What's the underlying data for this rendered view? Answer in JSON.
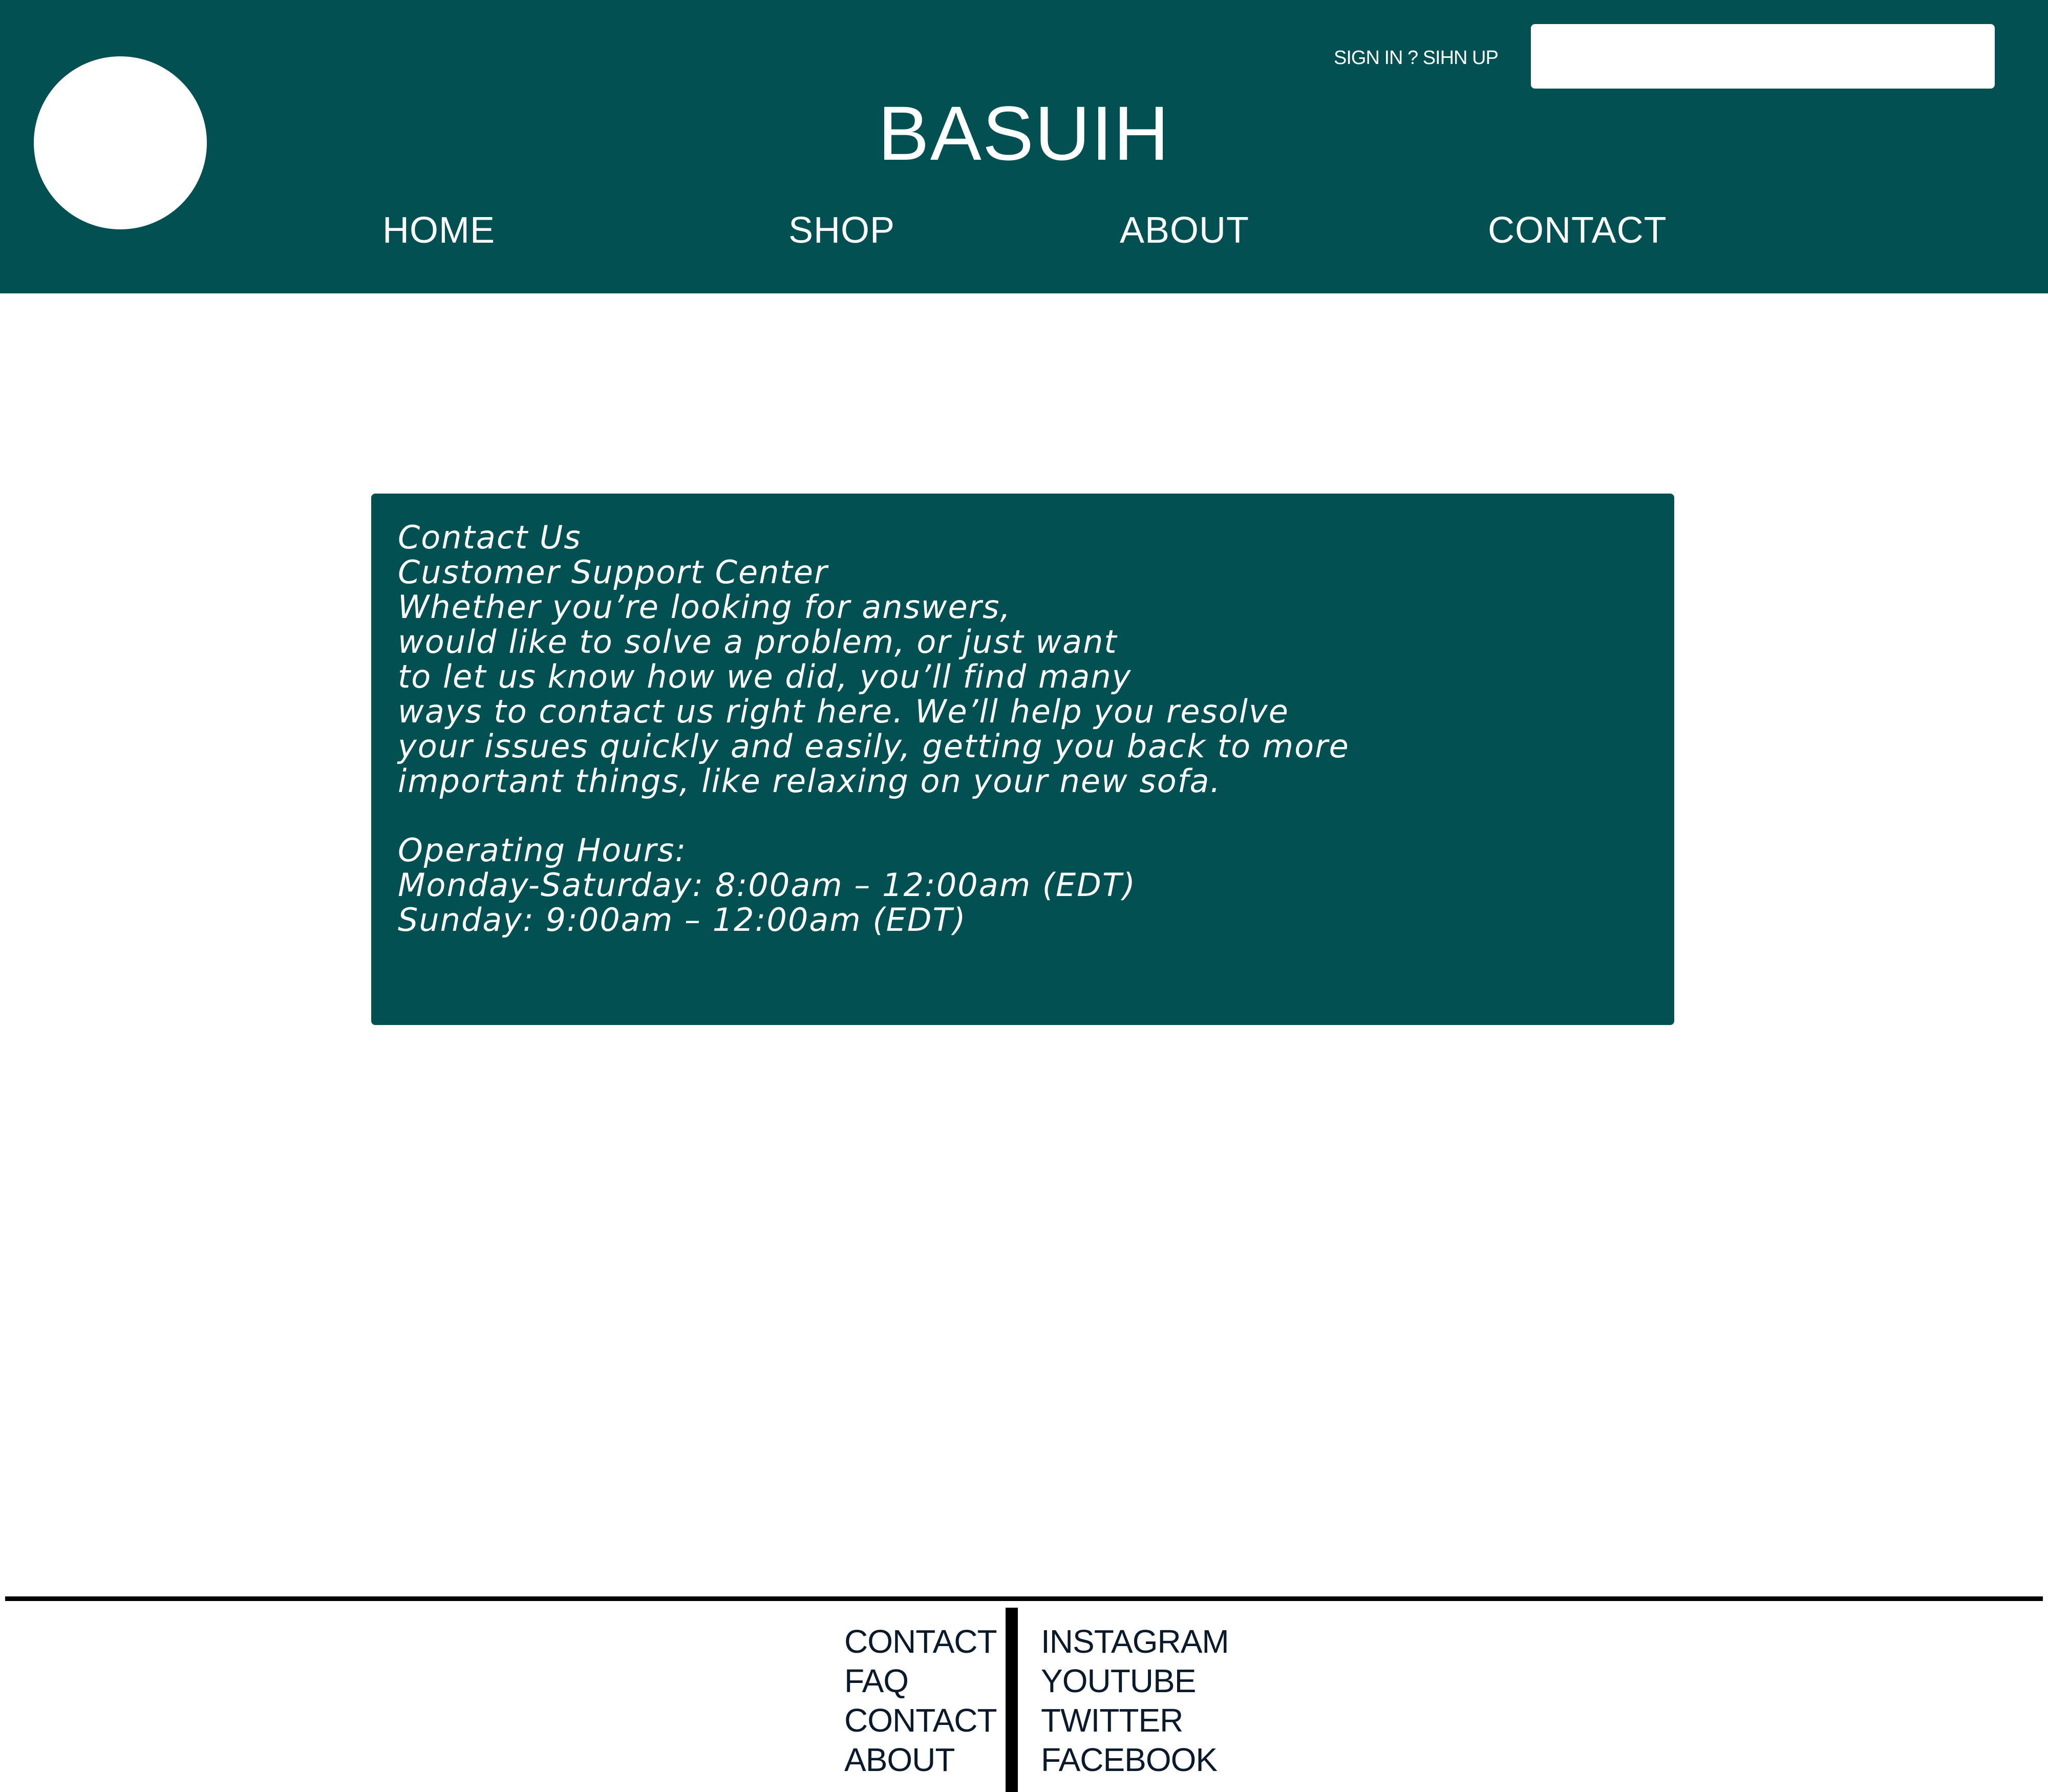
{
  "colors": {
    "brand_teal": "#035052",
    "background": "#ffffff",
    "footer_text": "#0b1a2a",
    "rule": "#000000"
  },
  "header": {
    "auth_link": "SIGN IN ? SIHN UP",
    "search_placeholder": "",
    "brand": "BASUIH",
    "nav": {
      "home": "HOME",
      "shop": "SHOP",
      "about": "ABOUT",
      "contact": "CONTACT"
    }
  },
  "contact": {
    "lines": [
      "Contact Us",
      "Customer Support Center",
      "Whether you’re looking for answers,",
      "would like to solve a problem, or just want",
      "to let us know how we did, you’ll find many",
      "ways to contact us right here. We’ll help you resolve",
      "your issues quickly and easily, getting you back to more",
      "important things, like relaxing on your new sofa."
    ],
    "hours_heading": "Operating Hours:",
    "hours": [
      "Monday-Saturday: 8:00am – 12:00am (EDT)",
      "Sunday: 9:00am – 12:00am (EDT)"
    ]
  },
  "footer": {
    "left_links": [
      "CONTACT",
      "FAQ",
      "CONTACT",
      "ABOUT"
    ],
    "right_links": [
      "INSTAGRAM",
      "YOUTUBE",
      "TWITTER",
      "FACEBOOK"
    ]
  }
}
